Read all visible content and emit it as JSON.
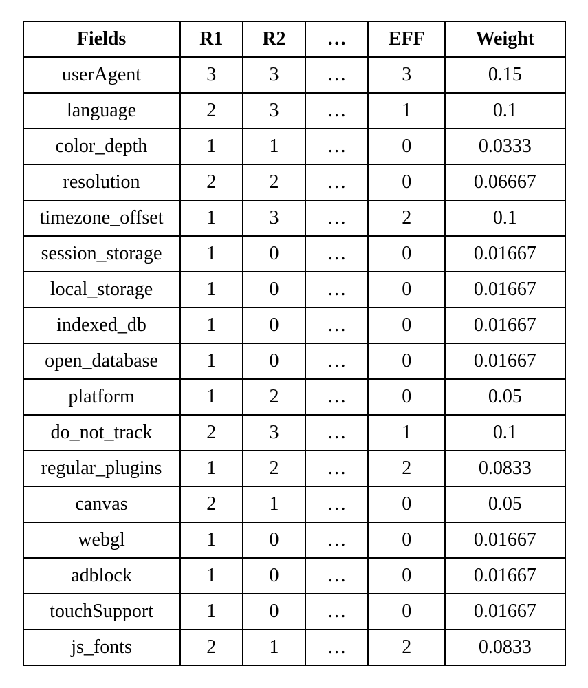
{
  "chart_data": {
    "type": "table",
    "headers": [
      "Fields",
      "R1",
      "R2",
      "…",
      "EFF",
      "Weight"
    ],
    "rows": [
      {
        "fields": "userAgent",
        "r1": "3",
        "r2": "3",
        "dots": "…",
        "eff": "3",
        "weight": "0.15"
      },
      {
        "fields": "language",
        "r1": "2",
        "r2": "3",
        "dots": "…",
        "eff": "1",
        "weight": "0.1"
      },
      {
        "fields": "color_depth",
        "r1": "1",
        "r2": "1",
        "dots": "…",
        "eff": "0",
        "weight": "0.0333"
      },
      {
        "fields": "resolution",
        "r1": "2",
        "r2": "2",
        "dots": "…",
        "eff": "0",
        "weight": "0.06667"
      },
      {
        "fields": "timezone_offset",
        "r1": "1",
        "r2": "3",
        "dots": "…",
        "eff": "2",
        "weight": "0.1"
      },
      {
        "fields": "session_storage",
        "r1": "1",
        "r2": "0",
        "dots": "…",
        "eff": "0",
        "weight": "0.01667"
      },
      {
        "fields": "local_storage",
        "r1": "1",
        "r2": "0",
        "dots": "…",
        "eff": "0",
        "weight": "0.01667"
      },
      {
        "fields": "indexed_db",
        "r1": "1",
        "r2": "0",
        "dots": "…",
        "eff": "0",
        "weight": "0.01667"
      },
      {
        "fields": "open_database",
        "r1": "1",
        "r2": "0",
        "dots": "…",
        "eff": "0",
        "weight": "0.01667"
      },
      {
        "fields": "platform",
        "r1": "1",
        "r2": "2",
        "dots": "…",
        "eff": "0",
        "weight": "0.05"
      },
      {
        "fields": "do_not_track",
        "r1": "2",
        "r2": "3",
        "dots": "…",
        "eff": "1",
        "weight": "0.1"
      },
      {
        "fields": "regular_plugins",
        "r1": "1",
        "r2": "2",
        "dots": "…",
        "eff": "2",
        "weight": "0.0833"
      },
      {
        "fields": "canvas",
        "r1": "2",
        "r2": "1",
        "dots": "…",
        "eff": "0",
        "weight": "0.05"
      },
      {
        "fields": "webgl",
        "r1": "1",
        "r2": "0",
        "dots": "…",
        "eff": "0",
        "weight": "0.01667"
      },
      {
        "fields": "adblock",
        "r1": "1",
        "r2": "0",
        "dots": "…",
        "eff": "0",
        "weight": "0.01667"
      },
      {
        "fields": "touchSupport",
        "r1": "1",
        "r2": "0",
        "dots": "…",
        "eff": "0",
        "weight": "0.01667"
      },
      {
        "fields": "js_fonts",
        "r1": "2",
        "r2": "1",
        "dots": "…",
        "eff": "2",
        "weight": "0.0833"
      }
    ]
  }
}
